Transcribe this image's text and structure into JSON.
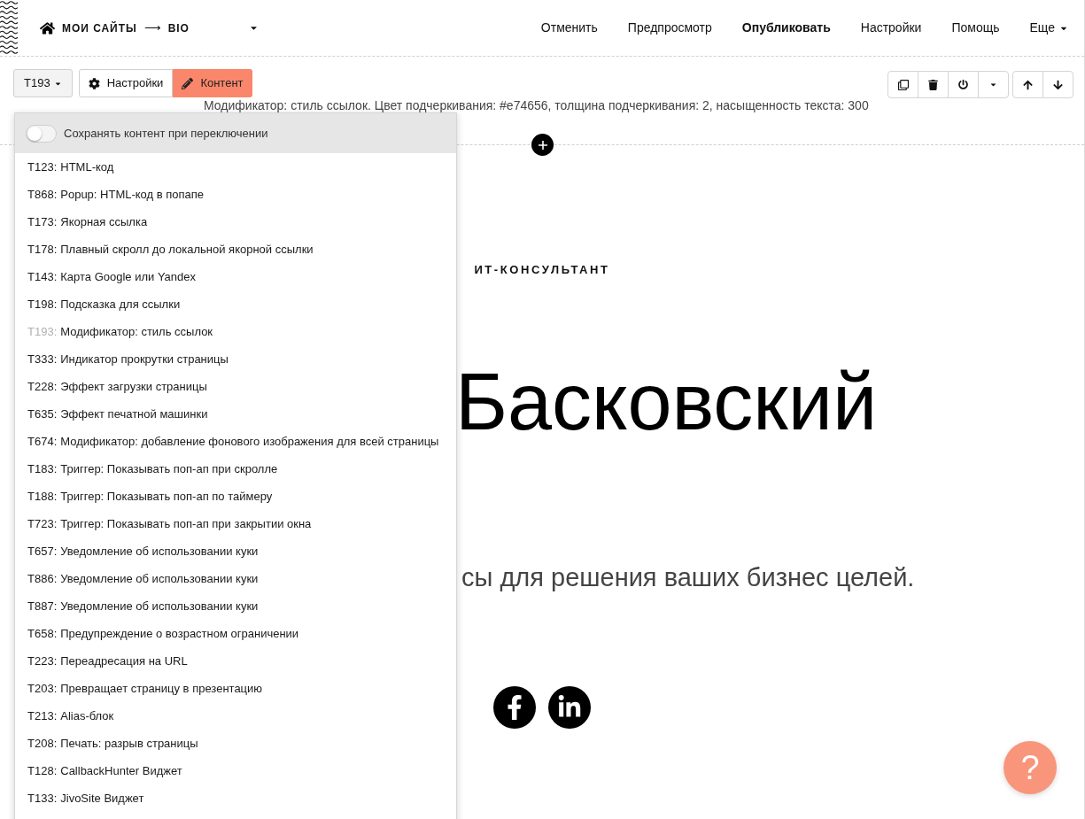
{
  "header": {
    "site_path": "МОИ САЙТЫ",
    "separator": "⟶",
    "page": "BIO",
    "nav": [
      {
        "label": "Отменить",
        "primary": false,
        "menu": false
      },
      {
        "label": "Предпросмотр",
        "primary": false,
        "menu": false
      },
      {
        "label": "Опубликовать",
        "primary": true,
        "menu": false
      },
      {
        "label": "Настройки",
        "primary": false,
        "menu": false
      },
      {
        "label": "Помощь",
        "primary": false,
        "menu": false
      },
      {
        "label": "Еще",
        "primary": false,
        "menu": true
      }
    ]
  },
  "block_toolbar": {
    "block_code": "T193",
    "tabs": [
      {
        "kind": "settings",
        "label": "Настройки",
        "selected": false
      },
      {
        "kind": "content",
        "label": "Контент",
        "selected": true
      }
    ],
    "description": "Модификатор: стиль ссылок. Цвет подчеркивания: #e74656, толщина подчеркивания: 2, насыщенность текста: 300"
  },
  "dropdown": {
    "toggle": {
      "label": "Сохранять контент при переключении",
      "on": false
    },
    "items": [
      {
        "code": "T123:",
        "name": "HTML-код",
        "selected": false
      },
      {
        "code": "T868:",
        "name": "Popup: HTML-код в попапе",
        "selected": false
      },
      {
        "code": "T173:",
        "name": "Якорная ссылка",
        "selected": false
      },
      {
        "code": "T178:",
        "name": "Плавный скролл до локальной якорной ссылки",
        "selected": false
      },
      {
        "code": "T143:",
        "name": "Карта Google или Yandex",
        "selected": false
      },
      {
        "code": "T198:",
        "name": "Подсказка для ссылки",
        "selected": false
      },
      {
        "code": "T193:",
        "name": "Модификатор: стиль ссылок",
        "selected": true
      },
      {
        "code": "T333:",
        "name": "Индикатор прокрутки страницы",
        "selected": false
      },
      {
        "code": "T228:",
        "name": "Эффект загрузки страницы",
        "selected": false
      },
      {
        "code": "T635:",
        "name": "Эффект печатной машинки",
        "selected": false
      },
      {
        "code": "T674:",
        "name": "Модификатор: добавление фонового изображения для всей страницы",
        "selected": false
      },
      {
        "code": "T183:",
        "name": "Триггер: Показывать поп-ап при скролле",
        "selected": false
      },
      {
        "code": "T188:",
        "name": "Триггер: Показывать поп-ап по таймеру",
        "selected": false
      },
      {
        "code": "T723:",
        "name": "Триггер: Показывать поп-ап при закрытии окна",
        "selected": false
      },
      {
        "code": "T657:",
        "name": "Уведомление об использовании куки",
        "selected": false
      },
      {
        "code": "T886:",
        "name": "Уведомление об использовании куки",
        "selected": false
      },
      {
        "code": "T887:",
        "name": "Уведомление об использовании куки",
        "selected": false
      },
      {
        "code": "T658:",
        "name": "Предупреждение о возрастном ограничении",
        "selected": false
      },
      {
        "code": "T223:",
        "name": "Переадресация на URL",
        "selected": false
      },
      {
        "code": "T203:",
        "name": "Превращает страницу в презентацию",
        "selected": false
      },
      {
        "code": "T213:",
        "name": "Alias-блок",
        "selected": false
      },
      {
        "code": "T208:",
        "name": "Печать: разрыв страницы",
        "selected": false
      },
      {
        "code": "T128:",
        "name": "CallbackHunter Виджет",
        "selected": false
      },
      {
        "code": "T133:",
        "name": "JivoSite Виджет",
        "selected": false
      }
    ]
  },
  "page": {
    "kicker": "ИТ-КОНСУЛЬТАНТ",
    "name": "Басковский",
    "tagline": "сы для решения ваших бизнес целей."
  },
  "help_button": {
    "label": "?"
  }
}
